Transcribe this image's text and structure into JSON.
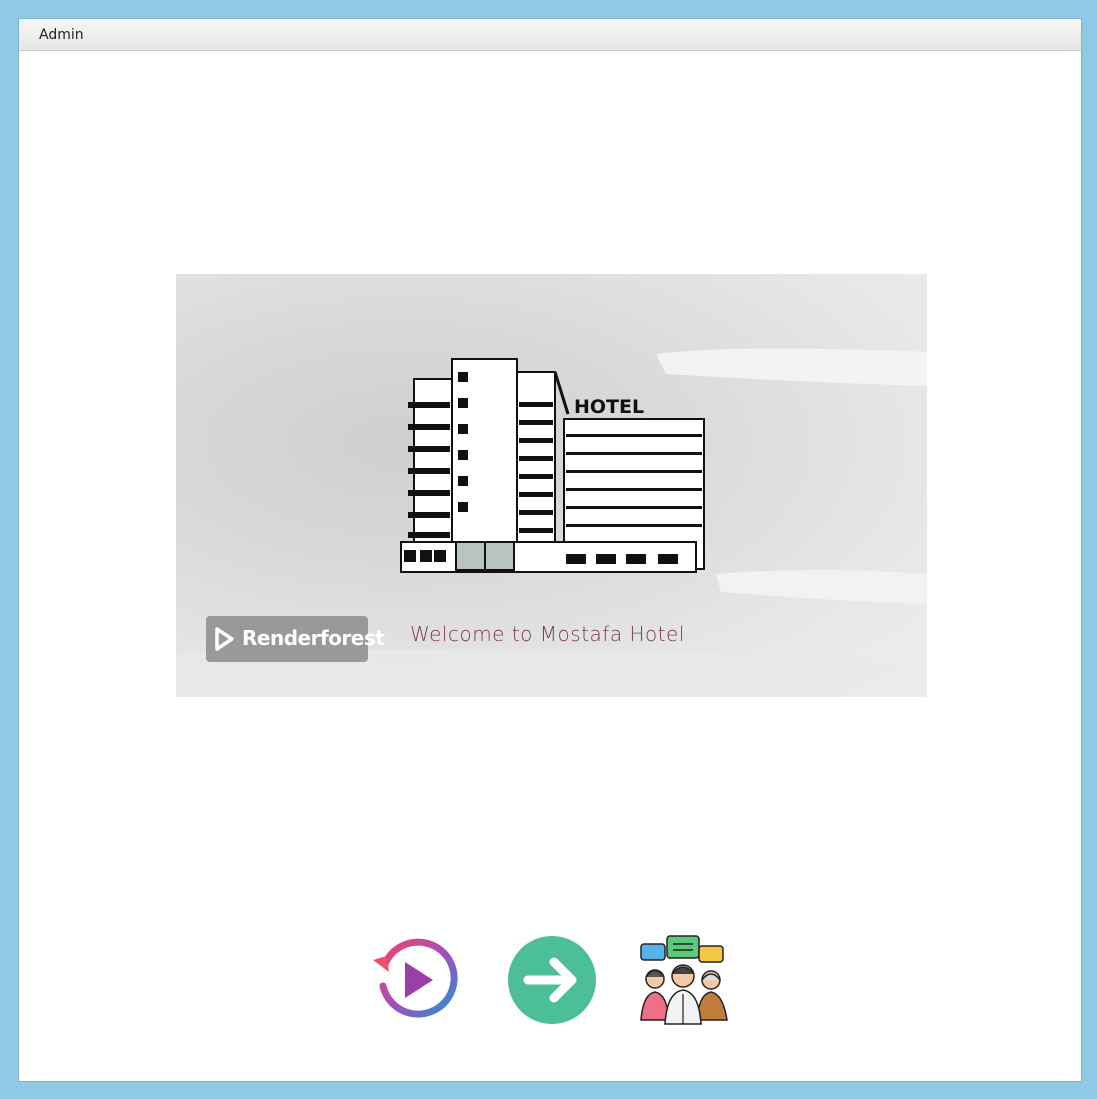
{
  "menubar": {
    "items": [
      {
        "label": "Admin"
      }
    ]
  },
  "video": {
    "sign_text": "HOTEL",
    "watermark": "Renderforest",
    "welcome_text": "Welcome to Mostafa Hotel"
  },
  "actions": [
    {
      "icon": "replay-icon"
    },
    {
      "icon": "arrow-right-icon"
    },
    {
      "icon": "people-chat-icon"
    }
  ],
  "colors": {
    "frame": "#8ecae6",
    "next_button": "#4dbf97",
    "welcome_text": "#7a3b45"
  }
}
